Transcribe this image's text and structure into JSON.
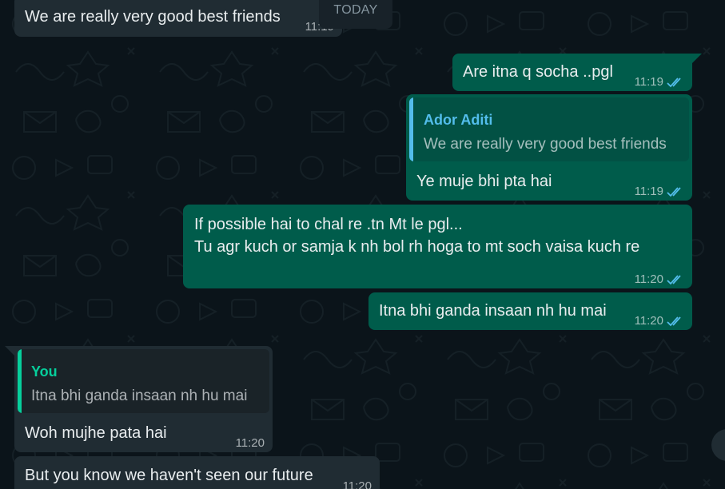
{
  "theme": {
    "background": "#0b141a",
    "incoming_bubble": "#202c33",
    "outgoing_bubble": "#005c4b",
    "read_tick_color": "#53bdeb",
    "quote_author_other": "#53bdeb",
    "quote_author_you": "#06cf9c"
  },
  "day_separator": "TODAY",
  "messages": [
    {
      "direction": "incoming",
      "text": "We are really very good best friends",
      "time": "11:19"
    },
    {
      "direction": "outgoing",
      "text": "Are itna q socha ..pgl",
      "time": "11:19",
      "status": "read"
    },
    {
      "direction": "outgoing",
      "quote": {
        "author": "Ador Aditi",
        "text": "We are really very good best friends"
      },
      "text": "Ye muje bhi pta hai",
      "time": "11:19",
      "status": "read"
    },
    {
      "direction": "outgoing",
      "lines": [
        "If possible hai to chal re .tn Mt le pgl...",
        "Tu agr kuch or samja k nh bol rh hoga to mt soch vaisa kuch re"
      ],
      "time": "11:20",
      "status": "read"
    },
    {
      "direction": "outgoing",
      "text": "Itna bhi ganda insaan nh hu mai",
      "time": "11:20",
      "status": "read"
    },
    {
      "direction": "incoming",
      "quote": {
        "author": "You",
        "text": "Itna bhi ganda insaan nh hu mai"
      },
      "text": "Woh mujhe pata hai",
      "time": "11:20"
    },
    {
      "direction": "incoming",
      "text": "But you know we haven't seen our future",
      "time": "11:20"
    }
  ]
}
